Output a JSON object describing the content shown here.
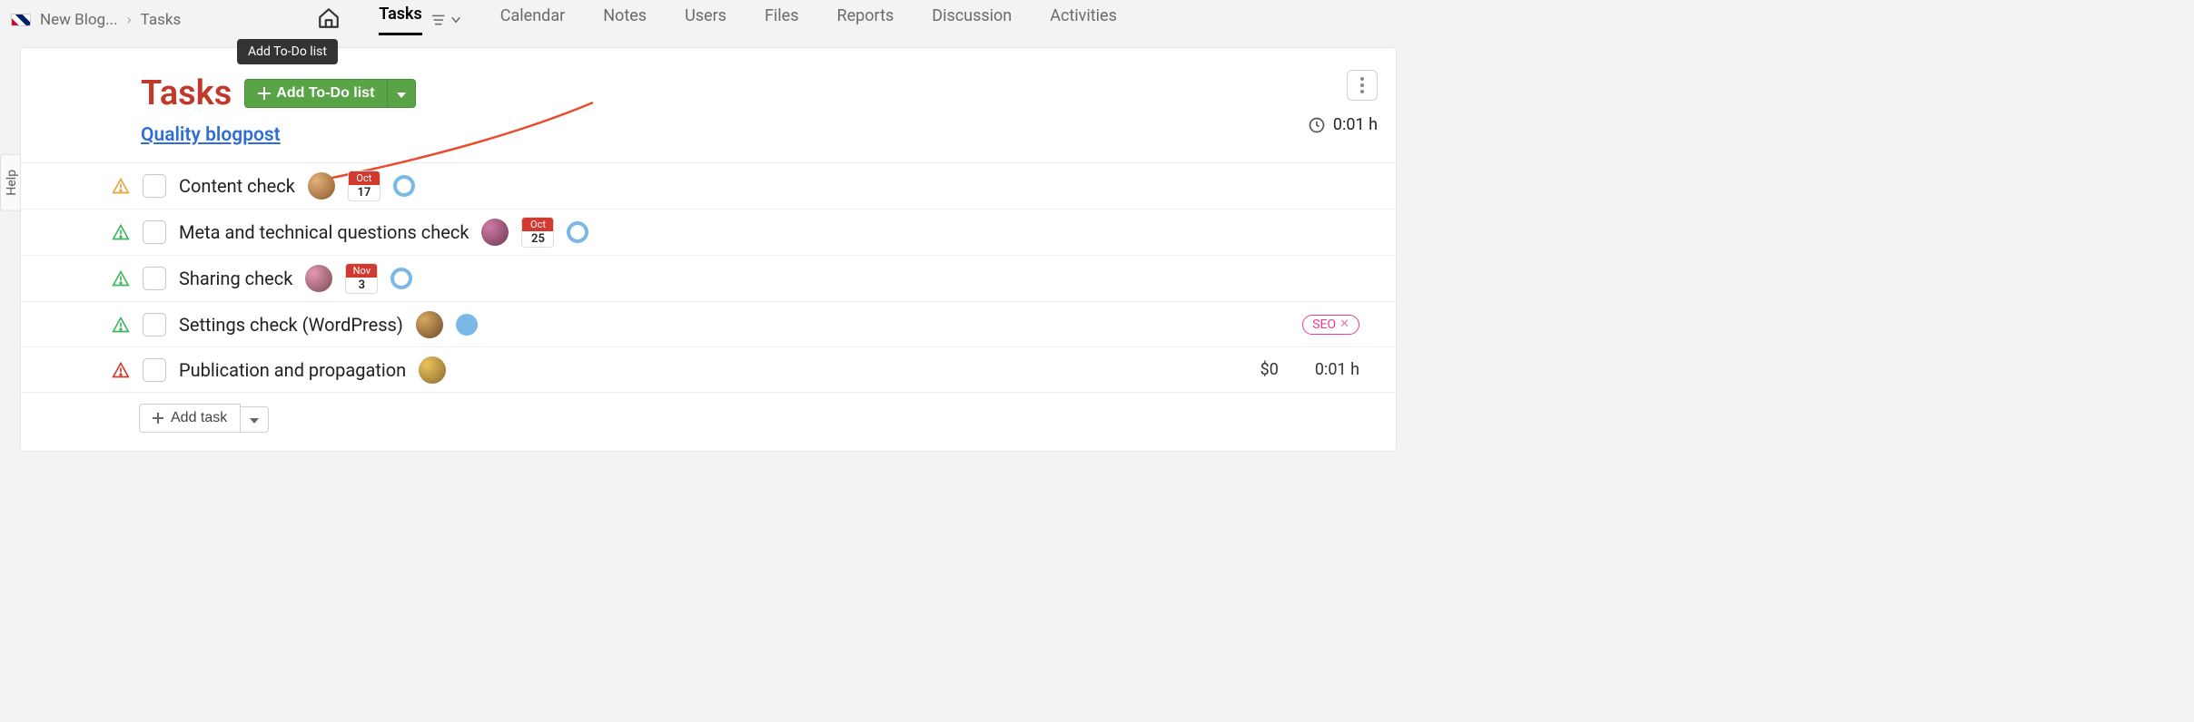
{
  "breadcrumb": {
    "root": "New Blog...",
    "current": "Tasks"
  },
  "nav": {
    "tasks": "Tasks",
    "calendar": "Calendar",
    "notes": "Notes",
    "users": "Users",
    "files": "Files",
    "reports": "Reports",
    "discussion": "Discussion",
    "activities": "Activities"
  },
  "page_title": "Tasks",
  "add_todo_button": "Add To-Do list",
  "tooltip_text": "Add To-Do list",
  "list_name": "Quality blogpost",
  "time_summary": "0:01 h",
  "tasks": [
    {
      "title": "Content check",
      "date_month": "Oct",
      "date_day": "17"
    },
    {
      "title": "Meta and technical questions check",
      "date_month": "Oct",
      "date_day": "25"
    },
    {
      "title": "Sharing check",
      "date_month": "Nov",
      "date_day": "3"
    },
    {
      "title": "Settings check (WordPress)",
      "tag": "SEO"
    },
    {
      "title": "Publication and propagation",
      "cost": "$0",
      "time": "0:01 h"
    }
  ],
  "add_task_label": "Add task",
  "help_label": "Help"
}
